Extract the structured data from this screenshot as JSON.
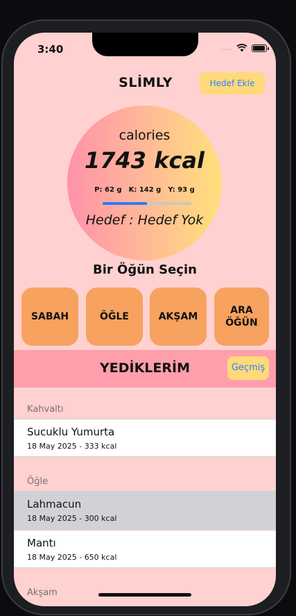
{
  "status": {
    "time": "3:40",
    "dots": "....",
    "wifi_icon": "wifi-icon",
    "battery_icon": "battery-icon"
  },
  "header": {
    "title": "SLİMLY",
    "add_goal_label": "Hedef Ekle"
  },
  "summary": {
    "calories_label": "calories",
    "calories_value": "1743 kcal",
    "protein": "P: 62 g",
    "carbs": "K: 142 g",
    "fat": "Y: 93 g",
    "progress_fraction": 0.5,
    "goal_text": "Hedef : Hedef Yok"
  },
  "meal_picker": {
    "title": "Bir Öğün Seçin",
    "buttons": [
      "SABAH",
      "ÖĞLE",
      "AKŞAM",
      "ARA\nÖĞÜN"
    ]
  },
  "eaten": {
    "title": "YEDİKLERİM",
    "history_label": "Geçmiş",
    "sections": [
      {
        "header": "Kahvaltı",
        "items": [
          {
            "name": "Sucuklu Yumurta",
            "detail": "18 May 2025 - 333 kcal"
          }
        ]
      },
      {
        "header": "Öğle",
        "items": [
          {
            "name": "Lahmacun",
            "detail": "18 May 2025 - 300 kcal",
            "selected": true
          },
          {
            "name": "Mantı",
            "detail": "18 May 2025 - 650 kcal"
          }
        ]
      },
      {
        "header": "Akşam",
        "items": []
      }
    ]
  },
  "colors": {
    "background": "#ffd1d1",
    "accent_yellow": "#ffd97a",
    "meal_orange": "#f7a25e",
    "header_pink": "#ff9fab",
    "link_blue": "#2f7fff"
  }
}
